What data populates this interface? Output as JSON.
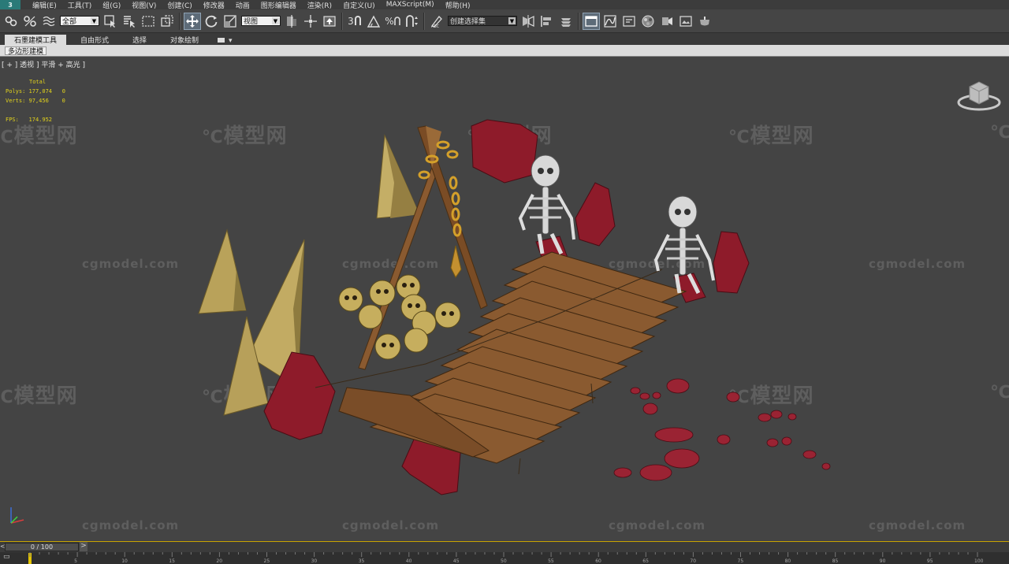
{
  "menu": {
    "items": [
      "编辑(E)",
      "工具(T)",
      "组(G)",
      "视图(V)",
      "创建(C)",
      "修改器",
      "动画",
      "图形编辑器",
      "渲染(R)",
      "自定义(U)",
      "MAXScript(M)",
      "帮助(H)"
    ]
  },
  "toolbar": {
    "filter_value": "全部",
    "ref_coord_value": "视图",
    "named_selection_placeholder": "创建选择集",
    "snap_label": "3",
    "angle_snap_label": "%"
  },
  "ribbon": {
    "tabs": [
      "石墨建模工具",
      "自由形式",
      "选择",
      "对象绘制"
    ],
    "more_label": "▾",
    "panel_label": "多边形建模"
  },
  "viewport": {
    "label": "[ + ] 透视 ] 平滑 + 高光 ]",
    "stats": {
      "header": "Total",
      "polys_label": "Polys:",
      "polys_total": "177,074",
      "polys_sel": "0",
      "verts_label": "Verts:",
      "verts_total": "97,456",
      "verts_sel": "0",
      "fps_label": "FPS:",
      "fps_value": "174.952"
    },
    "watermark_cn": "模型网",
    "watermark_en": "cgmodel.com"
  },
  "timeline": {
    "frame_display": "0 / 100",
    "prev_symbol": "<",
    "next_symbol": ">",
    "ticks": [
      "5",
      "10",
      "15",
      "20",
      "25",
      "30",
      "35",
      "40",
      "45",
      "50",
      "55",
      "60",
      "65",
      "70",
      "75",
      "80",
      "85",
      "90",
      "95",
      "100"
    ]
  },
  "colors": {
    "viewport_bg": "#444444",
    "stats_text": "#e2d21c",
    "timeline_accent": "#e3c300",
    "wood": "#8a5a30",
    "crimson_rock": "#8e1b2a",
    "golden_rock": "#c8b060"
  }
}
